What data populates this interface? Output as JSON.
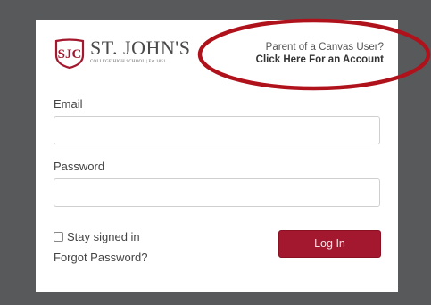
{
  "logo": {
    "title": "ST. JOHN'S",
    "subtitle": "COLLEGE HIGH SCHOOL | Est 1851",
    "mark_color": "#a3182e"
  },
  "parent_link": {
    "line1": "Parent of a Canvas User?",
    "line2": "Click Here For an Account"
  },
  "form": {
    "email_label": "Email",
    "email_value": "",
    "password_label": "Password",
    "password_value": "",
    "stay_signed_in_label": "Stay signed in",
    "stay_signed_in_checked": false,
    "forgot_label": "Forgot Password?",
    "login_label": "Log In"
  },
  "colors": {
    "background": "#58595b",
    "brand": "#a3182e",
    "annotation": "#b0121c"
  }
}
